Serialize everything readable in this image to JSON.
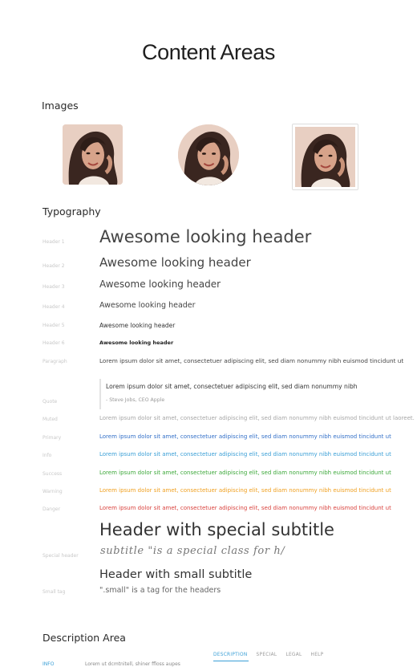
{
  "page": {
    "title": "Content Areas"
  },
  "images": {
    "section_title": "Images"
  },
  "typography": {
    "section_title": "Typography",
    "rows": [
      {
        "label": "Header 1",
        "text": "Awesome looking header"
      },
      {
        "label": "Header 2",
        "text": "Awesome looking header"
      },
      {
        "label": "Header 3",
        "text": "Awesome looking header"
      },
      {
        "label": "Header 4",
        "text": "Awesome looking header"
      },
      {
        "label": "Header 5",
        "text": "Awesome looking header"
      },
      {
        "label": "Header 6",
        "text": "Awesome looking header"
      },
      {
        "label": "Paragraph",
        "text": "Lorem ipsum dolor sit amet, consectetuer adipiscing elit, sed diam nonummy nibh euismod tincidunt ut"
      }
    ],
    "quote": {
      "label": "Quote",
      "text": "Lorem ipsum dolor sit amet, consectetuer adipiscing elit, sed diam nonummy nibh",
      "cite": "- Steve Jobs, CEO Apple"
    },
    "colored_rows": [
      {
        "label": "Muted",
        "text": "Lorem ipsum dolor sit amet, consectetuer adipiscing elit, sed diam nonummy nibh euismod tincidunt ut laoreet.",
        "color": "#a6a6a6"
      },
      {
        "label": "Primary",
        "text": "Lorem ipsum dolor sit amet, consectetuer adipiscing elit, sed diam nonummy nibh euismod tincidunt ut",
        "color": "#3370c8"
      },
      {
        "label": "Info",
        "text": "Lorem ipsum dolor sit amet, consectetuer adipiscing elit, sed diam nonummy nibh euismod tincidunt ut",
        "color": "#3a9fd6"
      },
      {
        "label": "Success",
        "text": "Lorem ipsum dolor sit amet, consectetuer adipiscing elit, sed diam nonummy nibh euismod tincidunt ut",
        "color": "#3da83a"
      },
      {
        "label": "Warning",
        "text": "Lorem ipsum dolor sit amet, consectetuer adipiscing elit, sed diam nonummy nibh euismod tincidunt ut",
        "color": "#f0a020"
      },
      {
        "label": "Danger",
        "text": "Lorem ipsum dolor sit amet, consectetuer adipiscing elit, sed diam nonummy nibh euismod tincidunt ut",
        "color": "#d9423d"
      }
    ],
    "special": {
      "label": "Special header",
      "header": "Header with special subtitle",
      "subtitle": "subtitle \"is a special class for h/"
    },
    "small": {
      "label": "Small tag",
      "header": "Header with small subtitle",
      "note": "\".small\" is a tag for the headers"
    }
  },
  "description": {
    "section_title": "Description Area",
    "tabs": [
      "DESCRIPTION",
      "SPECIAL",
      "LEGAL",
      "HELP"
    ],
    "info_label": "INFO",
    "info_text": "Lorem ut dcmtnitell, shiner ffloss aupes"
  },
  "colors": {
    "accent": "#3a9fd6"
  }
}
